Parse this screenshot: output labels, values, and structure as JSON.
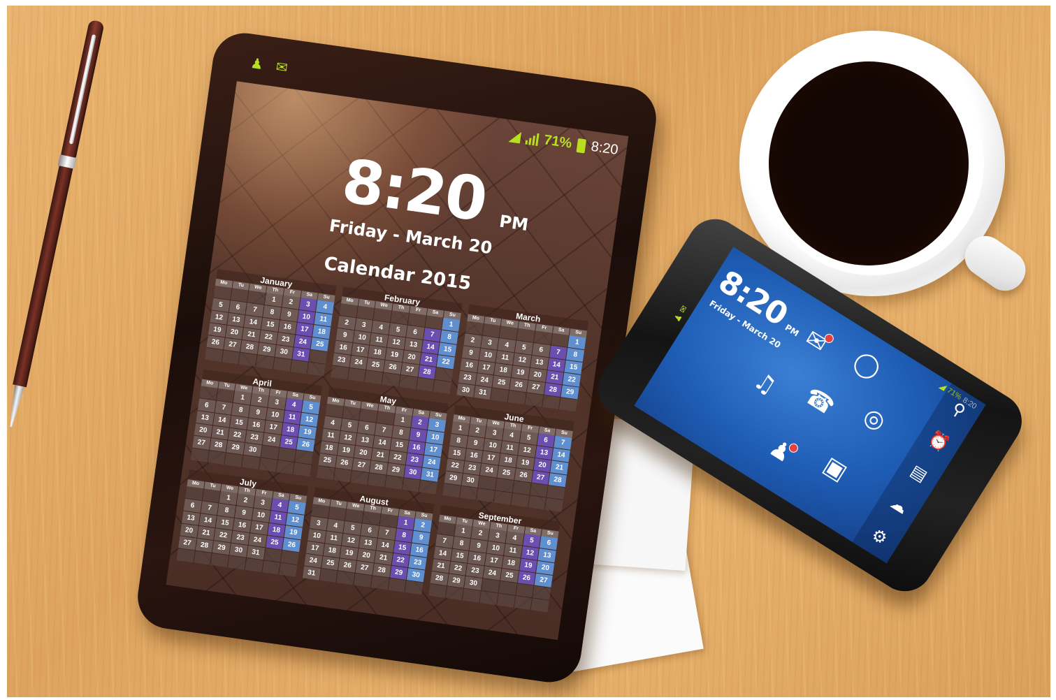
{
  "tablet": {
    "status_icons": [
      "contacts-icon",
      "mail-icon"
    ],
    "status": {
      "wifi_icon": "wifi-icon",
      "signal_icon": "signal-icon",
      "battery": "71%",
      "battery_icon": "battery-icon",
      "clock": "8:20"
    },
    "time": "8:20",
    "ampm": "PM",
    "date": "Friday - March 20",
    "calendar_title": "Calendar 2015",
    "day_headers": [
      "Mo",
      "Tu",
      "We",
      "Th",
      "Fr",
      "Sa",
      "Su"
    ],
    "months": [
      {
        "name": "January",
        "start": 3,
        "days": 31
      },
      {
        "name": "February",
        "start": 6,
        "days": 28
      },
      {
        "name": "March",
        "start": 6,
        "days": 31
      },
      {
        "name": "April",
        "start": 2,
        "days": 30
      },
      {
        "name": "May",
        "start": 4,
        "days": 31
      },
      {
        "name": "June",
        "start": 0,
        "days": 30
      },
      {
        "name": "July",
        "start": 2,
        "days": 31
      },
      {
        "name": "August",
        "start": 5,
        "days": 31
      },
      {
        "name": "September",
        "start": 1,
        "days": 30
      }
    ]
  },
  "phone": {
    "status": {
      "battery": "71%",
      "clock": "8:20"
    },
    "status_icons": [
      "contacts-icon",
      "mail-icon"
    ],
    "time": "8:20",
    "ampm": "PM",
    "date": "Friday - March 20",
    "apps": [
      "mail-icon",
      "chat-icon",
      "music-icon",
      "phone-icon",
      "globe-icon",
      "contacts-icon",
      "camera-icon"
    ],
    "dock": [
      "search-icon",
      "alarm-icon",
      "notes-icon",
      "weather-icon",
      "settings-icon"
    ]
  },
  "colors": {
    "accent_green": "#b8e020",
    "weekend_purple": "#6a4fb0",
    "sunday_blue": "#5f8fcf",
    "phone_blue": "#1e5cb4"
  }
}
